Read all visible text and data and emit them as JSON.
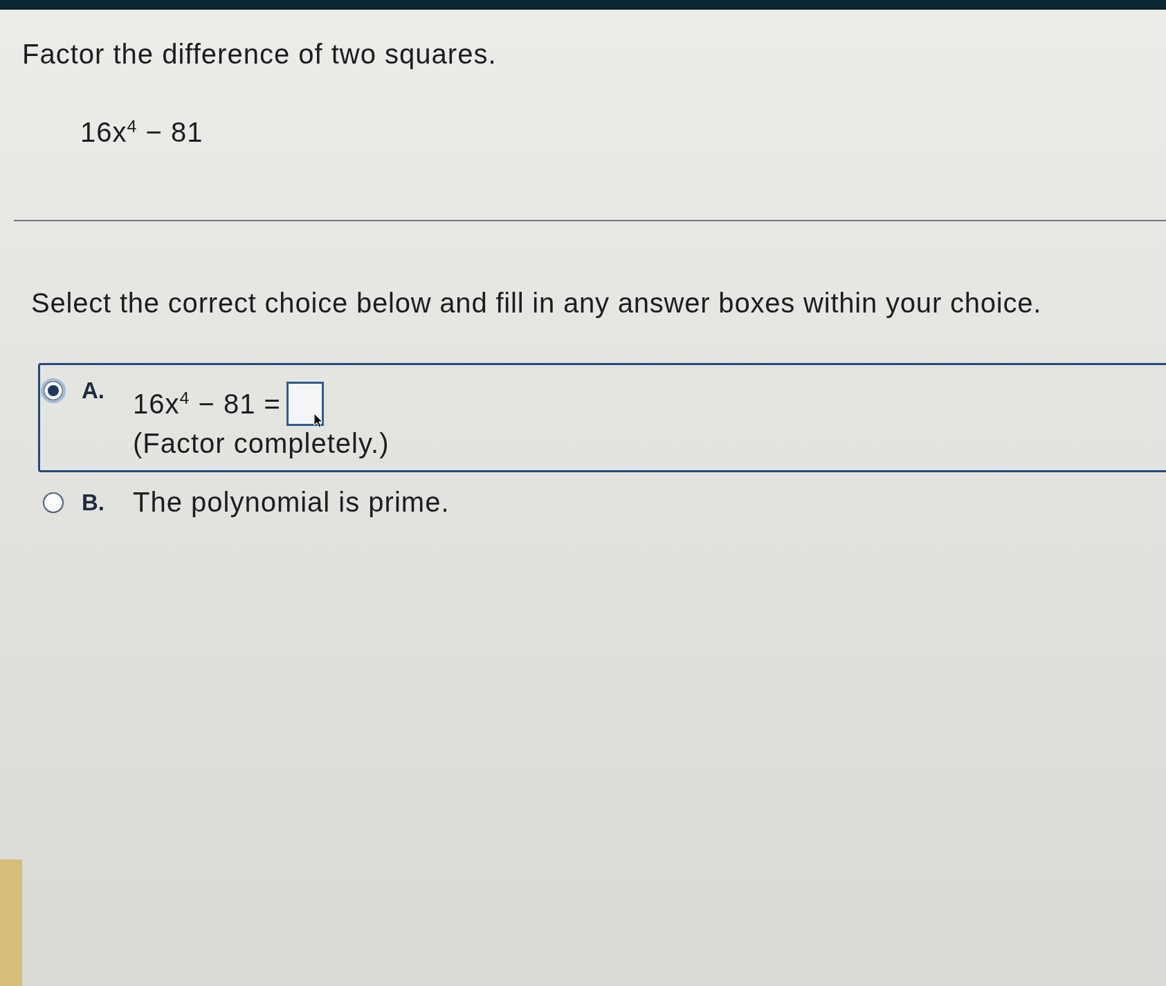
{
  "question": {
    "prompt": "Factor the difference of two squares.",
    "expression": "16x$^{4}$ − 81"
  },
  "instruction": "Select the correct choice below and fill in any answer boxes within your choice.",
  "choices": [
    {
      "kind": "answer_box",
      "letter": "A.",
      "expression": "16x$^{4}$ − 81 =",
      "note": "(Factor completely.)",
      "selected": true
    },
    {
      "kind": "text",
      "letter": "B.",
      "text": "The polynomial is prime.",
      "selected": false
    }
  ]
}
